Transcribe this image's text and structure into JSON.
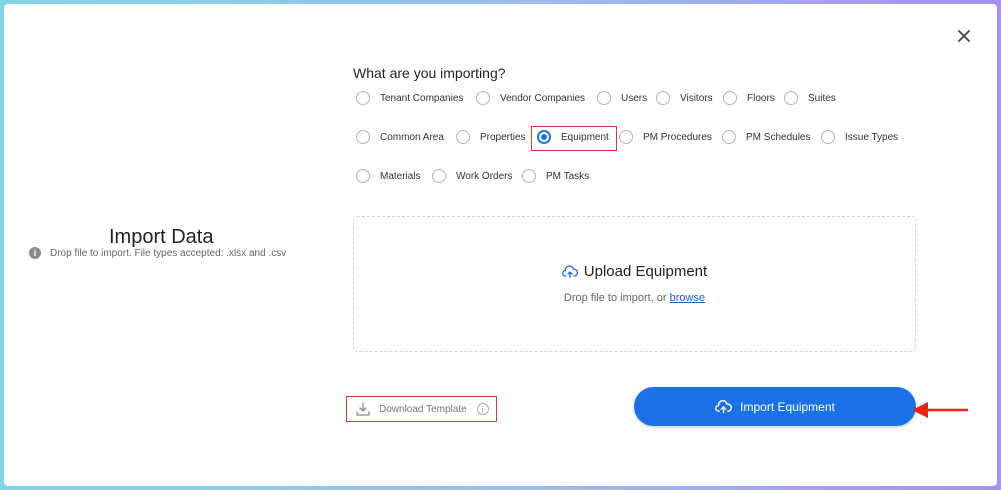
{
  "modal": {
    "close_icon": "close-icon"
  },
  "left": {
    "title": "Import Data",
    "info_text": "Drop file to import. File types accepted: .xlsx and .csv"
  },
  "question": "What are you importing?",
  "options": [
    {
      "label": "Tenant Companies",
      "checked": false
    },
    {
      "label": "Vendor Companies",
      "checked": false
    },
    {
      "label": "Users",
      "checked": false
    },
    {
      "label": "Visitors",
      "checked": false
    },
    {
      "label": "Floors",
      "checked": false
    },
    {
      "label": "Suites",
      "checked": false
    },
    {
      "label": "Common Area",
      "checked": false
    },
    {
      "label": "Properties",
      "checked": false
    },
    {
      "label": "Equipment",
      "checked": true
    },
    {
      "label": "PM Procedures",
      "checked": false
    },
    {
      "label": "PM Schedules",
      "checked": false
    },
    {
      "label": "Issue Types",
      "checked": false
    },
    {
      "label": "Materials",
      "checked": false
    },
    {
      "label": "Work Orders",
      "checked": false
    },
    {
      "label": "PM Tasks",
      "checked": false
    }
  ],
  "dropzone": {
    "title": "Upload Equipment",
    "sub_prefix": "Drop file to import, or ",
    "sub_link": "browse"
  },
  "download_template": {
    "label": "Download Template"
  },
  "import_button": {
    "label": "Import Equipment"
  },
  "colors": {
    "accent": "#1b72e8",
    "highlight": "#e03a2f",
    "arrow": "#e8231a"
  }
}
